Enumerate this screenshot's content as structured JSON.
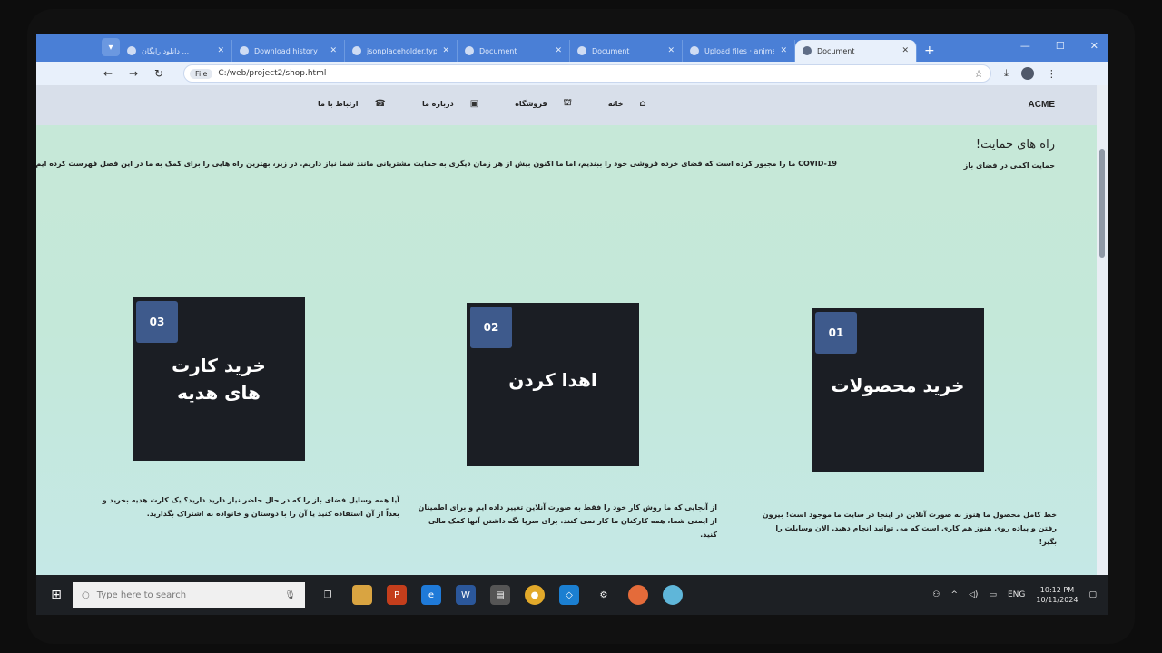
{
  "browser": {
    "tabs": [
      {
        "title": "دانلود رایگان ...",
        "icon": "globe-icon"
      },
      {
        "title": "Download history",
        "icon": "download-icon"
      },
      {
        "title": "jsonplaceholder.typic",
        "icon": "page-icon"
      },
      {
        "title": "Document",
        "icon": "globe-icon"
      },
      {
        "title": "Document",
        "icon": "globe-icon"
      },
      {
        "title": "Upload files · anjman",
        "icon": "github-icon"
      },
      {
        "title": "Document",
        "icon": "globe-icon",
        "active": true
      }
    ],
    "new_tab": "+",
    "file_chip": "File",
    "url": "C:/web/project2/shop.html"
  },
  "site": {
    "brand": "ACME",
    "nav": [
      {
        "label": "خانه",
        "icon": "home-icon"
      },
      {
        "label": "فروشگاه",
        "icon": "basket-icon"
      },
      {
        "label": "درباره ما",
        "icon": "id-card-icon"
      },
      {
        "label": "ارتباط با ما",
        "icon": "phone-icon"
      }
    ],
    "headline": "راه های حمایت!",
    "sub_left": "حمایت اکمی در فضای باز",
    "sub_main": "COVID-19 ما را مجبور کرده است که فضای خرده فروشی خود را ببندیم، اما ما اکنون بیش از هر زمان دیگری به حمایت مشتریانی مانند شما نیاز داریم. در زیر، بهترین راه هایی را برای کمک به ما در این فصل فهرست کرده ایم.",
    "cards": [
      {
        "num": "01",
        "title": "خرید محصولات",
        "desc": "خط کامل محصول ما هنوز به صورت آنلاین در اینجا در سایت ما موجود است! بیرون رفتن و پیاده روی هنوز هم کاری است که می توانید انجام دهید. الان وسایلت را بگیر!"
      },
      {
        "num": "02",
        "title": "اهدا کردن",
        "desc": "از آنجایی که ما روش کار خود را فقط به صورت آنلاین تغییر داده ایم و برای اطمینان از ایمنی شما، همه کارکنان ما کار نمی کنند. برای سرپا نگه داشتن آنها کمک مالی کنید."
      },
      {
        "num": "03",
        "title": "خرید کارت های هدیه",
        "desc": "آیا همه وسایل فضای باز را که در حال حاضر نیاز دارید دارید؟ یک کارت هدیه بخرید و بعداً از آن استفاده کنید یا آن را با دوستان و خانواده به اشتراک بگذارید."
      }
    ]
  },
  "taskbar": {
    "search_placeholder": "Type here to search",
    "lang": "ENG",
    "time": "10:12 PM",
    "date": "10/11/2024"
  },
  "colors": {
    "accent": "#3e5a8c",
    "card_bg": "#1b1e24",
    "page_bg": "#c7e8d8"
  }
}
